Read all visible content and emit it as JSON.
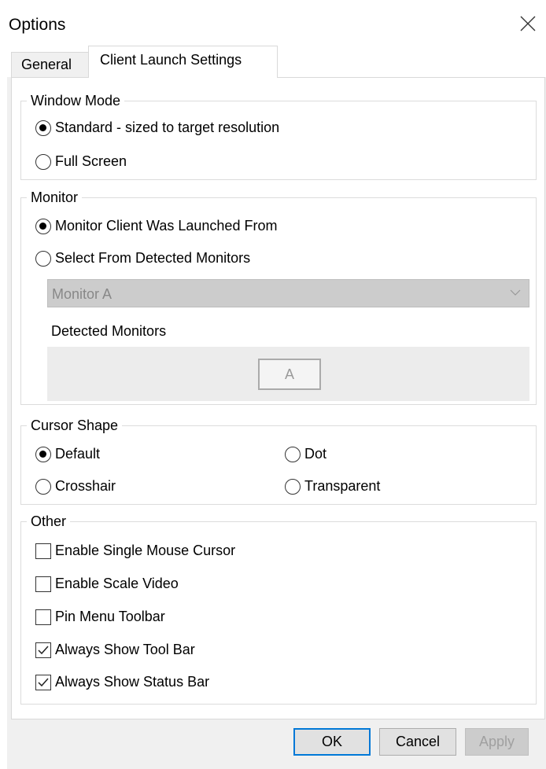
{
  "window": {
    "title": "Options"
  },
  "tabs": [
    {
      "label": "General",
      "active": false
    },
    {
      "label": "Client Launch Settings",
      "active": true
    }
  ],
  "window_mode": {
    "legend": "Window Mode",
    "options": [
      {
        "label": "Standard - sized to target resolution",
        "selected": true
      },
      {
        "label": "Full Screen",
        "selected": false
      }
    ]
  },
  "monitor": {
    "legend": "Monitor",
    "options": [
      {
        "label": "Monitor Client Was Launched From",
        "selected": true
      },
      {
        "label": "Select From Detected Monitors",
        "selected": false
      }
    ],
    "select_value": "Monitor A",
    "detected_label": "Detected Monitors",
    "detected_tiles": [
      "A"
    ]
  },
  "cursor_shape": {
    "legend": "Cursor Shape",
    "options": [
      {
        "label": "Default",
        "selected": true
      },
      {
        "label": "Dot",
        "selected": false
      },
      {
        "label": "Crosshair",
        "selected": false
      },
      {
        "label": "Transparent",
        "selected": false
      }
    ]
  },
  "other": {
    "legend": "Other",
    "checkboxes": [
      {
        "label": "Enable Single Mouse Cursor",
        "checked": false
      },
      {
        "label": "Enable Scale Video",
        "checked": false
      },
      {
        "label": "Pin Menu Toolbar",
        "checked": false
      },
      {
        "label": "Always Show Tool Bar",
        "checked": true
      },
      {
        "label": "Always Show Status Bar",
        "checked": true
      }
    ]
  },
  "buttons": {
    "ok": "OK",
    "cancel": "Cancel",
    "apply": "Apply"
  },
  "icons": {
    "close": "close-icon",
    "dropdown": "chevron-down-icon",
    "check": "checkmark-icon"
  }
}
